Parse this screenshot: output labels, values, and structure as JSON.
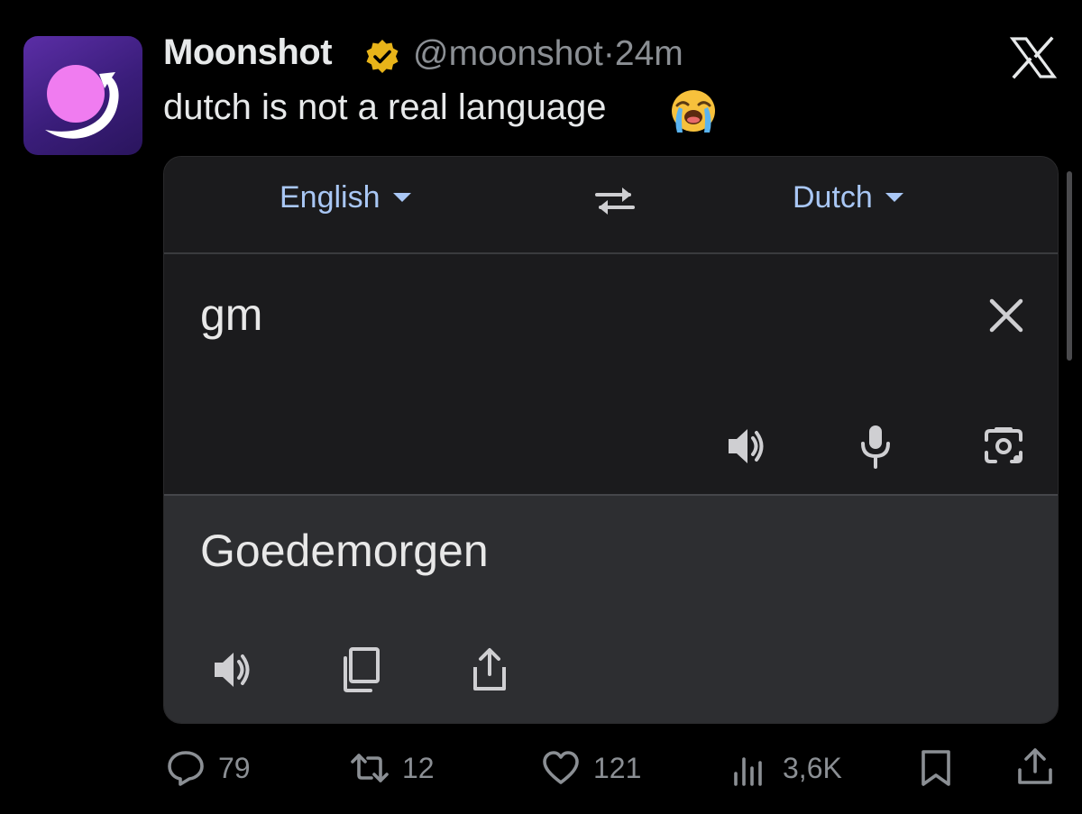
{
  "tweet": {
    "author_name": "Moonshot",
    "handle": "@moonshot",
    "separator": "·",
    "time": "24m",
    "text": "dutch is not a real language",
    "emoji": "loudly-crying-face",
    "verified": true,
    "verified_badge_color": "#e8b419"
  },
  "icons": {
    "avatar": "moonshot-logo",
    "platform": "x-logo"
  },
  "translate_card": {
    "source_language": "English",
    "target_language": "Dutch",
    "swap_icon": "swap-arrows-icon",
    "input_text": "gm",
    "output_text": "Goedemorgen",
    "input_icons": [
      "speaker-icon",
      "microphone-icon",
      "camera-icon"
    ],
    "output_icons": [
      "speaker-icon",
      "copy-icon",
      "share-icon"
    ],
    "accent_color": "#a9c7f5"
  },
  "actions": {
    "replies": "79",
    "reposts": "12",
    "likes": "121",
    "views": "3,6K"
  }
}
